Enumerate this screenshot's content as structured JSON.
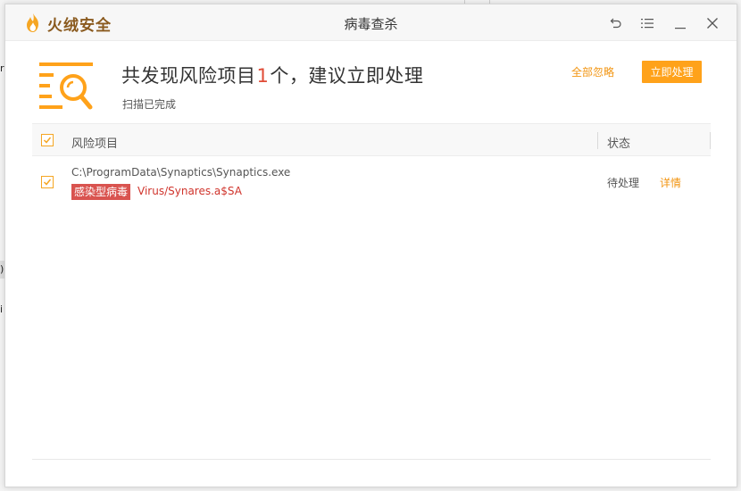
{
  "background": {
    "fragment_r": "r",
    "fragment_paren": ")",
    "fragment_i": "i"
  },
  "window": {
    "brand_name": "火绒安全",
    "title": "病毒查杀",
    "controls": [
      "back-icon",
      "menu-icon",
      "minimize-icon",
      "close-icon"
    ]
  },
  "summary": {
    "headline_prefix": "共发现风险项目",
    "count": "1",
    "headline_suffix": "个，建议立即处理",
    "status": "扫描已完成",
    "ignore_all": "全部忽略",
    "handle_now": "立即处理"
  },
  "table": {
    "columns": {
      "risk": "风险项目",
      "status": "状态"
    },
    "rows": [
      {
        "checked": true,
        "path": "C:\\ProgramData\\Synaptics\\Synaptics.exe",
        "tag": "感染型病毒",
        "virus_name": "Virus/Synares.a$SA",
        "status": "待处理",
        "action": "详情"
      }
    ]
  },
  "colors": {
    "accent": "#ffa21a",
    "link": "#f29512",
    "danger": "#d9534f",
    "brand": "#8a5a1e"
  }
}
